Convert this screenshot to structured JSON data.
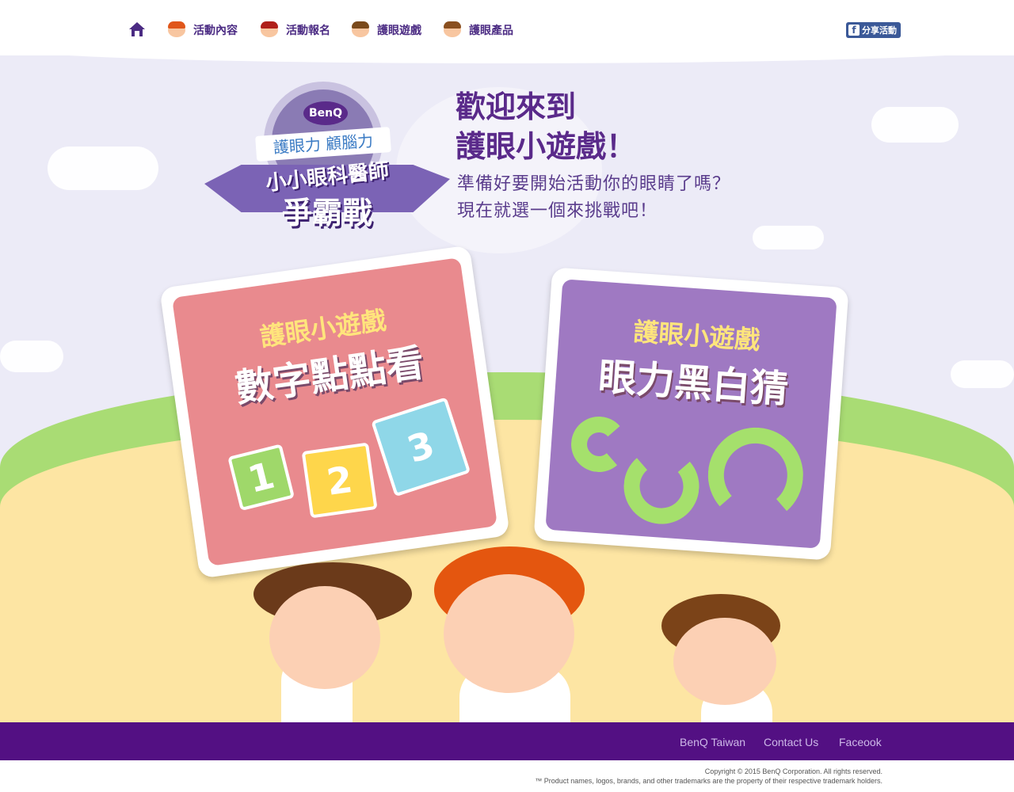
{
  "nav": {
    "items": [
      {
        "label": "活動內容"
      },
      {
        "label": "活動報名"
      },
      {
        "label": "護眼遊戲"
      },
      {
        "label": "護眼產品"
      }
    ],
    "share": "分享活動"
  },
  "logo": {
    "brand": "BenQ",
    "tagline": "護眼力 顧腦力",
    "line1": "小小眼科醫師",
    "line2": "爭霸戰"
  },
  "hero": {
    "title1": "歡迎來到",
    "title2": "護眼小遊戲！",
    "sub1": "準備好要開始活動你的眼睛了嗎？",
    "sub2": "現在就選一個來挑戰吧！"
  },
  "games": [
    {
      "top": "護眼小遊戲",
      "name": "數字點點看",
      "numbers": [
        "1",
        "2",
        "3"
      ]
    },
    {
      "top": "護眼小遊戲",
      "name": "眼力黑白猜"
    }
  ],
  "footer": {
    "links": [
      "BenQ Taiwan",
      "Contact Us",
      "Faceook"
    ],
    "copyright": "Copyright © 2015 BenQ Corporation. All rights reserved.",
    "trademark": "™ Product names, logos, brands, and other trademarks are the property of their respective trademark holders."
  }
}
